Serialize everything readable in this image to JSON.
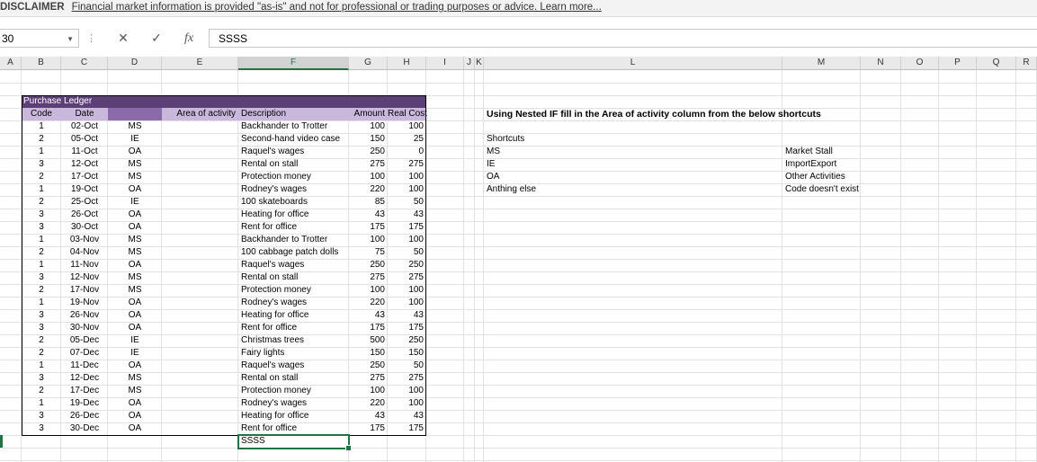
{
  "disclaimer": {
    "tag": "DISCLAIMER",
    "message": "Financial market information is provided \"as-is\" and not for professional or trading purposes or advice. Learn more..."
  },
  "formula_bar": {
    "name_box": "30",
    "formula": "SSSS",
    "cancel_glyph": "✕",
    "enter_glyph": "✓",
    "fx_glyph": "fx"
  },
  "columns": [
    "A",
    "B",
    "C",
    "D",
    "E",
    "F",
    "G",
    "H",
    "I",
    "J",
    "K",
    "L",
    "M",
    "N",
    "O",
    "P",
    "Q",
    "R"
  ],
  "selected_column": "F",
  "ledger": {
    "title": "Purchase Ledger",
    "headers": {
      "code": "Code",
      "date": "Date",
      "d": "",
      "area": "Area of activity",
      "description": "Description",
      "amount": "Amount",
      "real_cost": "Real Cost"
    },
    "rows": [
      {
        "code": "1",
        "date": "02-Oct",
        "type": "MS",
        "desc": "Backhander to Trotter",
        "amount": "100",
        "real": "100"
      },
      {
        "code": "2",
        "date": "05-Oct",
        "type": "IE",
        "desc": "Second-hand video case",
        "amount": "150",
        "real": "25"
      },
      {
        "code": "1",
        "date": "11-Oct",
        "type": "OA",
        "desc": "Raquel's wages",
        "amount": "250",
        "real": "0"
      },
      {
        "code": "3",
        "date": "12-Oct",
        "type": "MS",
        "desc": "Rental on stall",
        "amount": "275",
        "real": "275"
      },
      {
        "code": "2",
        "date": "17-Oct",
        "type": "MS",
        "desc": "Protection money",
        "amount": "100",
        "real": "100"
      },
      {
        "code": "1",
        "date": "19-Oct",
        "type": "OA",
        "desc": "Rodney's wages",
        "amount": "220",
        "real": "100"
      },
      {
        "code": "2",
        "date": "25-Oct",
        "type": "IE",
        "desc": "100 skateboards",
        "amount": "85",
        "real": "50"
      },
      {
        "code": "3",
        "date": "26-Oct",
        "type": "OA",
        "desc": "Heating for office",
        "amount": "43",
        "real": "43"
      },
      {
        "code": "3",
        "date": "30-Oct",
        "type": "OA",
        "desc": "Rent for office",
        "amount": "175",
        "real": "175"
      },
      {
        "code": "1",
        "date": "03-Nov",
        "type": "MS",
        "desc": "Backhander to Trotter",
        "amount": "100",
        "real": "100"
      },
      {
        "code": "2",
        "date": "04-Nov",
        "type": "MS",
        "desc": "100 cabbage patch dolls",
        "amount": "75",
        "real": "50"
      },
      {
        "code": "1",
        "date": "11-Nov",
        "type": "OA",
        "desc": "Raquel's wages",
        "amount": "250",
        "real": "250"
      },
      {
        "code": "3",
        "date": "12-Nov",
        "type": "MS",
        "desc": "Rental on stall",
        "amount": "275",
        "real": "275"
      },
      {
        "code": "2",
        "date": "17-Nov",
        "type": "MS",
        "desc": "Protection money",
        "amount": "100",
        "real": "100"
      },
      {
        "code": "1",
        "date": "19-Nov",
        "type": "OA",
        "desc": "Rodney's wages",
        "amount": "220",
        "real": "100"
      },
      {
        "code": "3",
        "date": "26-Nov",
        "type": "OA",
        "desc": "Heating for office",
        "amount": "43",
        "real": "43"
      },
      {
        "code": "3",
        "date": "30-Nov",
        "type": "OA",
        "desc": "Rent for office",
        "amount": "175",
        "real": "175"
      },
      {
        "code": "2",
        "date": "05-Dec",
        "type": "IE",
        "desc": "Christmas trees",
        "amount": "500",
        "real": "250"
      },
      {
        "code": "2",
        "date": "07-Dec",
        "type": "IE",
        "desc": "Fairy lights",
        "amount": "150",
        "real": "150"
      },
      {
        "code": "1",
        "date": "11-Dec",
        "type": "OA",
        "desc": "Raquel's wages",
        "amount": "250",
        "real": "50"
      },
      {
        "code": "3",
        "date": "12-Dec",
        "type": "MS",
        "desc": "Rental on stall",
        "amount": "275",
        "real": "275"
      },
      {
        "code": "2",
        "date": "17-Dec",
        "type": "MS",
        "desc": "Protection money",
        "amount": "100",
        "real": "100"
      },
      {
        "code": "1",
        "date": "19-Dec",
        "type": "OA",
        "desc": "Rodney's wages",
        "amount": "220",
        "real": "100"
      },
      {
        "code": "3",
        "date": "26-Dec",
        "type": "OA",
        "desc": "Heating for office",
        "amount": "43",
        "real": "43"
      },
      {
        "code": "3",
        "date": "30-Dec",
        "type": "OA",
        "desc": "Rent for office",
        "amount": "175",
        "real": "175"
      }
    ]
  },
  "instructions": {
    "title": "Using Nested IF fill in the Area of activity column from the below shortcuts",
    "shortcuts_label": "Shortcuts",
    "items": [
      {
        "code": "MS",
        "meaning": "Market Stall"
      },
      {
        "code": "IE",
        "meaning": "ImportExport"
      },
      {
        "code": "OA",
        "meaning": "Other Activities"
      },
      {
        "code": "Anthing else",
        "meaning": "Code doesn't exist"
      }
    ]
  },
  "active_cell": {
    "value": "SSSS"
  },
  "colors": {
    "ledger_title_bg": "#5d3f77",
    "header_light": "#c9b8dc",
    "header_dark": "#8a6aa9",
    "excel_green": "#217346"
  }
}
